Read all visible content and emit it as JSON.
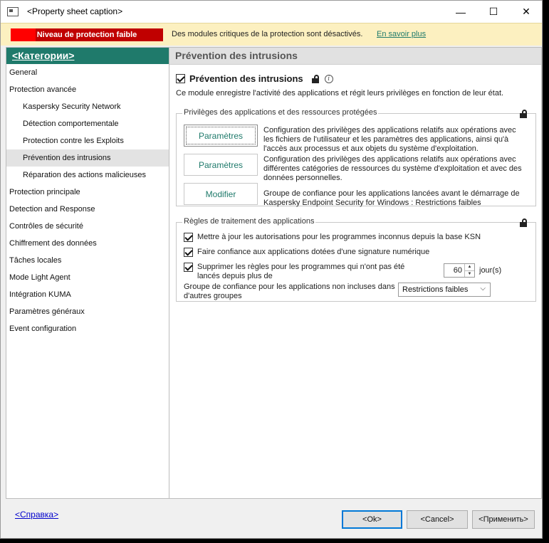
{
  "window": {
    "title": "<Property sheet caption>"
  },
  "warning": {
    "level": "Niveau de protection faible",
    "message": "Des modules critiques de la protection sont désactivés.",
    "link": "En savoir plus"
  },
  "sidebar": {
    "header": "<Категории>",
    "items": [
      {
        "label": "General",
        "sub": false
      },
      {
        "label": "Protection avancée",
        "sub": false
      },
      {
        "label": "Kaspersky Security Network",
        "sub": true
      },
      {
        "label": "Détection comportementale",
        "sub": true
      },
      {
        "label": "Protection contre les Exploits",
        "sub": true
      },
      {
        "label": "Prévention des intrusions",
        "sub": true,
        "selected": true
      },
      {
        "label": "Réparation des actions malicieuses",
        "sub": true
      },
      {
        "label": "Protection principale",
        "sub": false
      },
      {
        "label": "Detection and Response",
        "sub": false
      },
      {
        "label": "Contrôles de sécurité",
        "sub": false
      },
      {
        "label": "Chiffrement des données",
        "sub": false
      },
      {
        "label": "Tâches locales",
        "sub": false
      },
      {
        "label": "Mode Light Agent",
        "sub": false
      },
      {
        "label": "Intégration KUMA",
        "sub": false
      },
      {
        "label": "Paramètres généraux",
        "sub": false
      },
      {
        "label": "Event configuration",
        "sub": false
      }
    ]
  },
  "main": {
    "header": "Prévention des intrusions",
    "module": {
      "label": "Prévention des intrusions",
      "checked": true,
      "description": "Ce module enregistre l'activité des applications et régit leurs privilèges en fonction de leur état."
    },
    "privileges_group": {
      "title": "Privilèges des applications et des ressources protégées",
      "entries": [
        {
          "button": "Paramètres",
          "description": "Configuration des privilèges des applications relatifs aux opérations avec les fichiers de l'utilisateur et les paramètres des applications, ainsi qu'à l'accès aux processus et aux objets du système d'exploitation."
        },
        {
          "button": "Paramètres",
          "description": "Configuration des privilèges des applications relatifs aux opérations avec différentes catégories de ressources du système d'exploitation et avec des données personnelles."
        },
        {
          "button": "Modifier",
          "description": "Groupe de confiance pour les applications lancées avant le démarrage de Kaspersky Endpoint Security for Windows : Restrictions faibles"
        }
      ]
    },
    "rules_group": {
      "title": "Règles de traitement des applications",
      "checkboxes": [
        {
          "label": "Mettre à jour les autorisations pour les programmes inconnus depuis la base KSN",
          "checked": true
        },
        {
          "label": "Faire confiance aux applications dotées d'une signature numérique",
          "checked": true
        },
        {
          "label": "Supprimer les règles pour les programmes qui n'ont pas été lancés depuis plus de",
          "checked": true
        }
      ],
      "days_value": "60",
      "days_unit": "jour(s)",
      "trust_group_label": "Groupe de confiance pour les applications non incluses dans d'autres groupes",
      "trust_group_value": "Restrictions faibles"
    }
  },
  "footer": {
    "help": "<Справка>",
    "ok": "<Ok>",
    "cancel": "<Cancel>",
    "apply": "<Применить>"
  },
  "colors": {
    "accent": "#1f7a6b",
    "danger": "#c00000",
    "warning_bg": "#fcf0c0"
  }
}
